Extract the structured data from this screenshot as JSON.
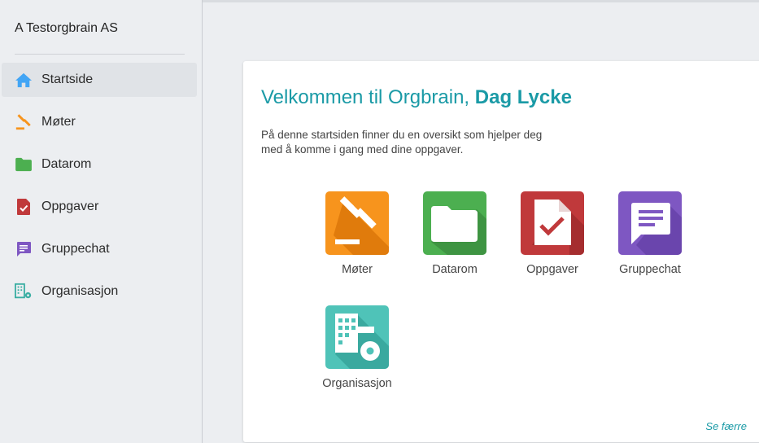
{
  "sidebar": {
    "org_name": "A Testorgbrain AS",
    "items": [
      {
        "label": "Startside",
        "icon": "home-icon",
        "active": true
      },
      {
        "label": "Møter",
        "icon": "gavel-icon"
      },
      {
        "label": "Datarom",
        "icon": "folder-icon"
      },
      {
        "label": "Oppgaver",
        "icon": "task-icon"
      },
      {
        "label": "Gruppechat",
        "icon": "chat-icon"
      },
      {
        "label": "Organisasjon",
        "icon": "organization-icon"
      }
    ]
  },
  "main": {
    "welcome_prefix": "Velkommen til Orgbrain, ",
    "user_name": "Dag Lycke",
    "intro": "På denne startsiden finner du en oversikt som hjelper deg med å komme i gang med dine oppgaver.",
    "tiles": [
      {
        "label": "Møter",
        "icon": "gavel-icon",
        "color": "#f7941d"
      },
      {
        "label": "Datarom",
        "icon": "folder-icon",
        "color": "#4caf50"
      },
      {
        "label": "Oppgaver",
        "icon": "task-icon",
        "color": "#c0393b"
      },
      {
        "label": "Gruppechat",
        "icon": "chat-icon",
        "color": "#7e57c2"
      },
      {
        "label": "Organisasjon",
        "icon": "organization-icon",
        "color": "#4fc3b8"
      }
    ],
    "see_less": "Se færre"
  },
  "colors": {
    "accent": "#1a9aa6",
    "home_icon": "#42a5f5"
  }
}
